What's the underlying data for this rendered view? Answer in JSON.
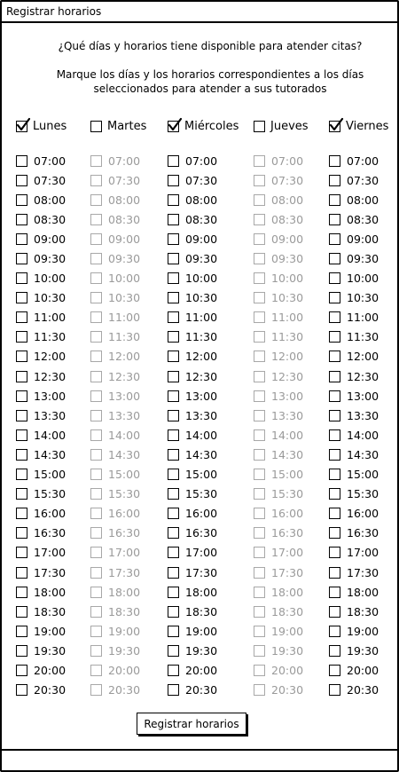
{
  "window": {
    "title": "Registrar horarios"
  },
  "question": "¿Qué días y horarios tiene disponible para atender citas?",
  "instructions_line1": "Marque los días y los horarios correspondientes a los días",
  "instructions_line2": "seleccionados para atender a sus tutorados",
  "days": [
    {
      "label": "Lunes",
      "checked": true
    },
    {
      "label": "Martes",
      "checked": false
    },
    {
      "label": "Miércoles",
      "checked": true
    },
    {
      "label": "Jueves",
      "checked": false
    },
    {
      "label": "Viernes",
      "checked": true
    }
  ],
  "times": [
    "07:00",
    "07:30",
    "08:00",
    "08:30",
    "09:00",
    "09:30",
    "10:00",
    "10:30",
    "11:00",
    "11:30",
    "12:00",
    "12:30",
    "13:00",
    "13:30",
    "14:00",
    "14:30",
    "15:00",
    "15:30",
    "16:00",
    "16:30",
    "17:00",
    "17:30",
    "18:00",
    "18:30",
    "19:00",
    "19:30",
    "20:00",
    "20:30"
  ],
  "submit_label": "Registrar horarios",
  "colors": {
    "border": "#000000",
    "disabled_text": "#9a9a9a",
    "disabled_border": "#a8a8a8"
  }
}
